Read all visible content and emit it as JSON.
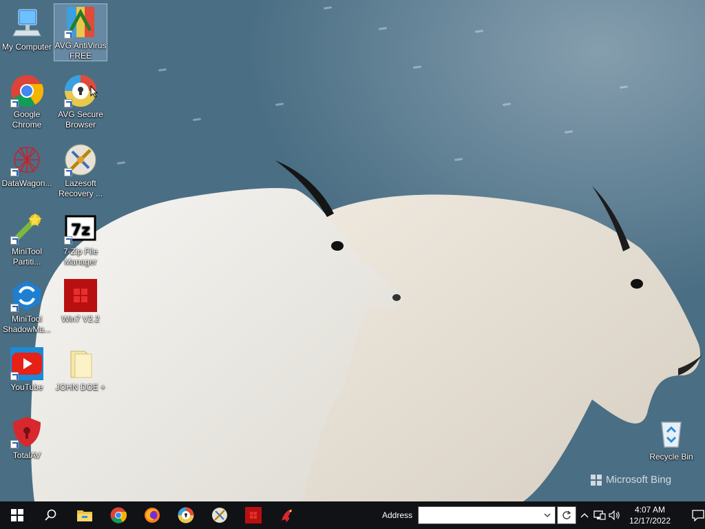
{
  "desktop": {
    "icons": [
      {
        "label": "My Computer",
        "icon": "computer-icon"
      },
      {
        "label": "AVG AntiVirus FREE",
        "icon": "avg-antivirus-icon"
      },
      {
        "label": "Google Chrome",
        "icon": "chrome-icon"
      },
      {
        "label": "AVG Secure Browser",
        "icon": "avg-secure-browser-icon"
      },
      {
        "label": "DataWagon...",
        "icon": "datawagon-icon"
      },
      {
        "label": "Lazesoft Recovery ...",
        "icon": "lazesoft-icon"
      },
      {
        "label": "MiniTool Partiti...",
        "icon": "minitool-partition-icon"
      },
      {
        "label": "7-Zip File Manager",
        "icon": "7zip-icon"
      },
      {
        "label": "MiniTool ShadowMa...",
        "icon": "minitool-shadowmaker-icon"
      },
      {
        "label": "Win7 V2.2",
        "icon": "win7-icon"
      },
      {
        "label": "YouTube",
        "icon": "youtube-icon"
      },
      {
        "label": "JOHN DOE +",
        "icon": "folder-icon"
      },
      {
        "label": "TotalAV",
        "icon": "totalav-icon"
      },
      {
        "label": "Recycle Bin",
        "icon": "recycle-bin-icon"
      }
    ],
    "watermark": "Microsoft Bing"
  },
  "taskbar": {
    "pinned": [
      "start-icon",
      "search-icon",
      "file-explorer-icon",
      "chrome-icon",
      "firefox-icon",
      "avg-secure-browser-icon",
      "lazesoft-icon",
      "win7-icon",
      "dragon-app-icon"
    ],
    "address_label": "Address",
    "address_value": "",
    "clock_time": "4:07 AM",
    "clock_date": "12/17/2022"
  },
  "colors": {
    "taskbar": "#101216",
    "selection": "#a0bedc"
  }
}
